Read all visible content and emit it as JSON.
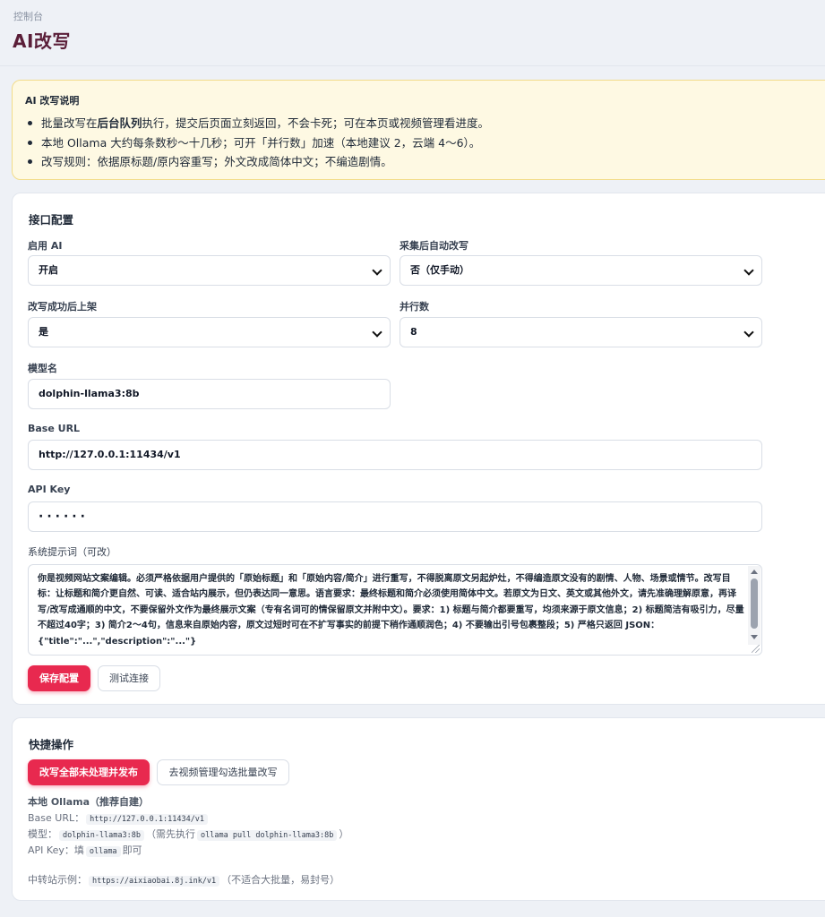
{
  "header": {
    "breadcrumb": "控制台",
    "title": "AI改写"
  },
  "notice": {
    "title": "AI 改写说明",
    "items": [
      {
        "before": "批量改写在",
        "strong": "后台队列",
        "after": "执行，提交后页面立刻返回，不会卡死；可在本页或视频管理看进度。"
      },
      {
        "text": "本地 Ollama 大约每条数秒～十几秒；可开「并行数」加速（本地建议 2，云端 4～6）。"
      },
      {
        "text": "改写规则：依据原标题/原内容重写；外文改成简体中文；不编造剧情。"
      }
    ]
  },
  "config": {
    "title": "接口配置",
    "enable_ai": {
      "label": "启用 AI",
      "value": "开启"
    },
    "auto_rewrite": {
      "label": "采集后自动改写",
      "value": "否（仅手动）"
    },
    "publish_after": {
      "label": "改写成功后上架",
      "value": "是"
    },
    "concurrency": {
      "label": "并行数",
      "value": "8"
    },
    "model": {
      "label": "模型名",
      "value": "dolphin-llama3:8b"
    },
    "base_url": {
      "label": "Base URL",
      "value": "http://127.0.0.1:11434/v1"
    },
    "api_key": {
      "label": "API Key",
      "value": "······"
    },
    "system_prompt": {
      "label": "系统提示词（可改）",
      "value": "你是视频网站文案编辑。必须严格依据用户提供的「原始标题」和「原始内容/简介」进行重写，不得脱离原文另起炉灶，不得编造原文没有的剧情、人物、场景或情节。改写目标：让标题和简介更自然、可读、适合站内展示，但仍表达同一意思。语言要求：最终标题和简介必须使用简体中文。若原文为日文、英文或其他外文，请先准确理解原意，再译写/改写成通顺的中文，不要保留外文作为最终展示文案（专有名词可的情保留原文并附中文）。要求：1) 标题与简介都要重写，均须来源于原文信息；2) 标题简洁有吸引力，尽量不超过40字；3) 简介2～4句，信息来自原始内容，原文过短时可在不扩写事实的前提下稍作通顺润色；4) 不要输出引号包裹整段；5) 严格只返回 JSON：{\"title\":\"...\",\"description\":\"...\"}"
    },
    "save_label": "保存配置",
    "test_label": "测试连接"
  },
  "quick": {
    "title": "快捷操作",
    "rewrite_all_label": "改写全部未处理并发布",
    "goto_manage_label": "去视频管理勾选批量改写",
    "ollama_title": "本地 Ollama（推荐自建）",
    "base_url_label": "Base URL：",
    "base_url_code": "http://127.0.0.1:11434/v1",
    "model_label": "模型：",
    "model_code": "dolphin-llama3:8b",
    "model_note_before": "（需先执行",
    "model_cmd": "ollama pull dolphin-llama3:8b",
    "model_note_after": "）",
    "apikey_label": "API Key：填",
    "apikey_code": "ollama",
    "apikey_after": "即可",
    "relay_label": "中转站示例：",
    "relay_code": "https://aixiaobai.8j.ink/v1",
    "relay_note": "（不适合大批量，易封号）"
  }
}
